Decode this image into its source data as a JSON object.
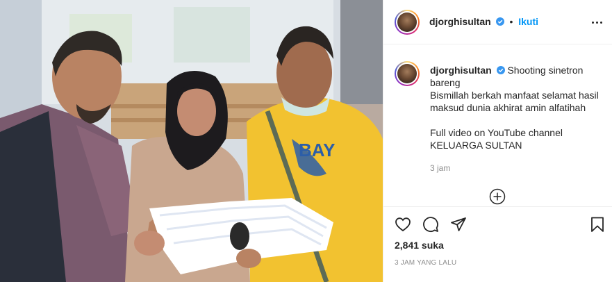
{
  "post": {
    "username": "djorghisultan",
    "follow_label": "Ikuti",
    "separator": "•",
    "caption_lines": [
      "Shooting sinetron",
      "bareng",
      "Bismillah berkah manfaat selamat hasil",
      "maksud dunia akhirat amin alfatihah",
      "",
      "Full video on YouTube channel",
      "KELUARGA SULTAN"
    ],
    "caption_time": "3 jam",
    "likes": "2,841 suka",
    "posted_ago": "3 JAM YANG LALU"
  },
  "icons": {
    "verified": "verified-badge-icon",
    "more": "more-options-icon",
    "load_more": "plus-circle-icon",
    "like": "heart-icon",
    "comment": "comment-icon",
    "share": "share-icon",
    "save": "bookmark-icon"
  },
  "colors": {
    "accent": "#0095f6",
    "verified": "#3897f0",
    "text": "#262626",
    "muted": "#8e8e8e",
    "border": "#efefef"
  }
}
